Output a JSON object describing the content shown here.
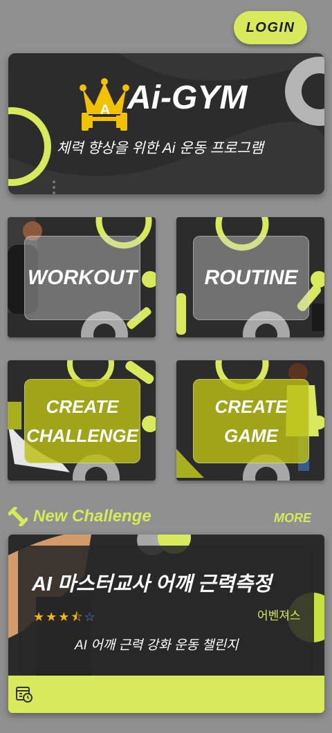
{
  "header": {
    "login_label": "LOGIN"
  },
  "hero": {
    "title": "Ai-GYM",
    "crown_letter": "A",
    "subtitle": "체력 향상을 위한 Ai 운동 프로그램"
  },
  "menu": {
    "workout": "WORKOUT",
    "routine": "ROUTINE",
    "create_challenge_line1": "CREATE",
    "create_challenge_line2": "CHALLENGE",
    "create_game_line1": "CREATE",
    "create_game_line2": "GAME"
  },
  "section": {
    "title": "New Challenge",
    "more_label": "MORE",
    "icon": "dumbbell-icon"
  },
  "challenge": {
    "title": "AI 마스터교사 어깨 근력측정",
    "rating": 3.5,
    "rating_max": 5,
    "author": "어벤져스",
    "description": "AI 어깨 근력 강화 운동 챌린지",
    "footer_icon": "schedule-icon"
  },
  "colors": {
    "accent": "#d8ea5c",
    "background": "#909090",
    "card": "#2c2c2c",
    "star": "#f5b800"
  }
}
